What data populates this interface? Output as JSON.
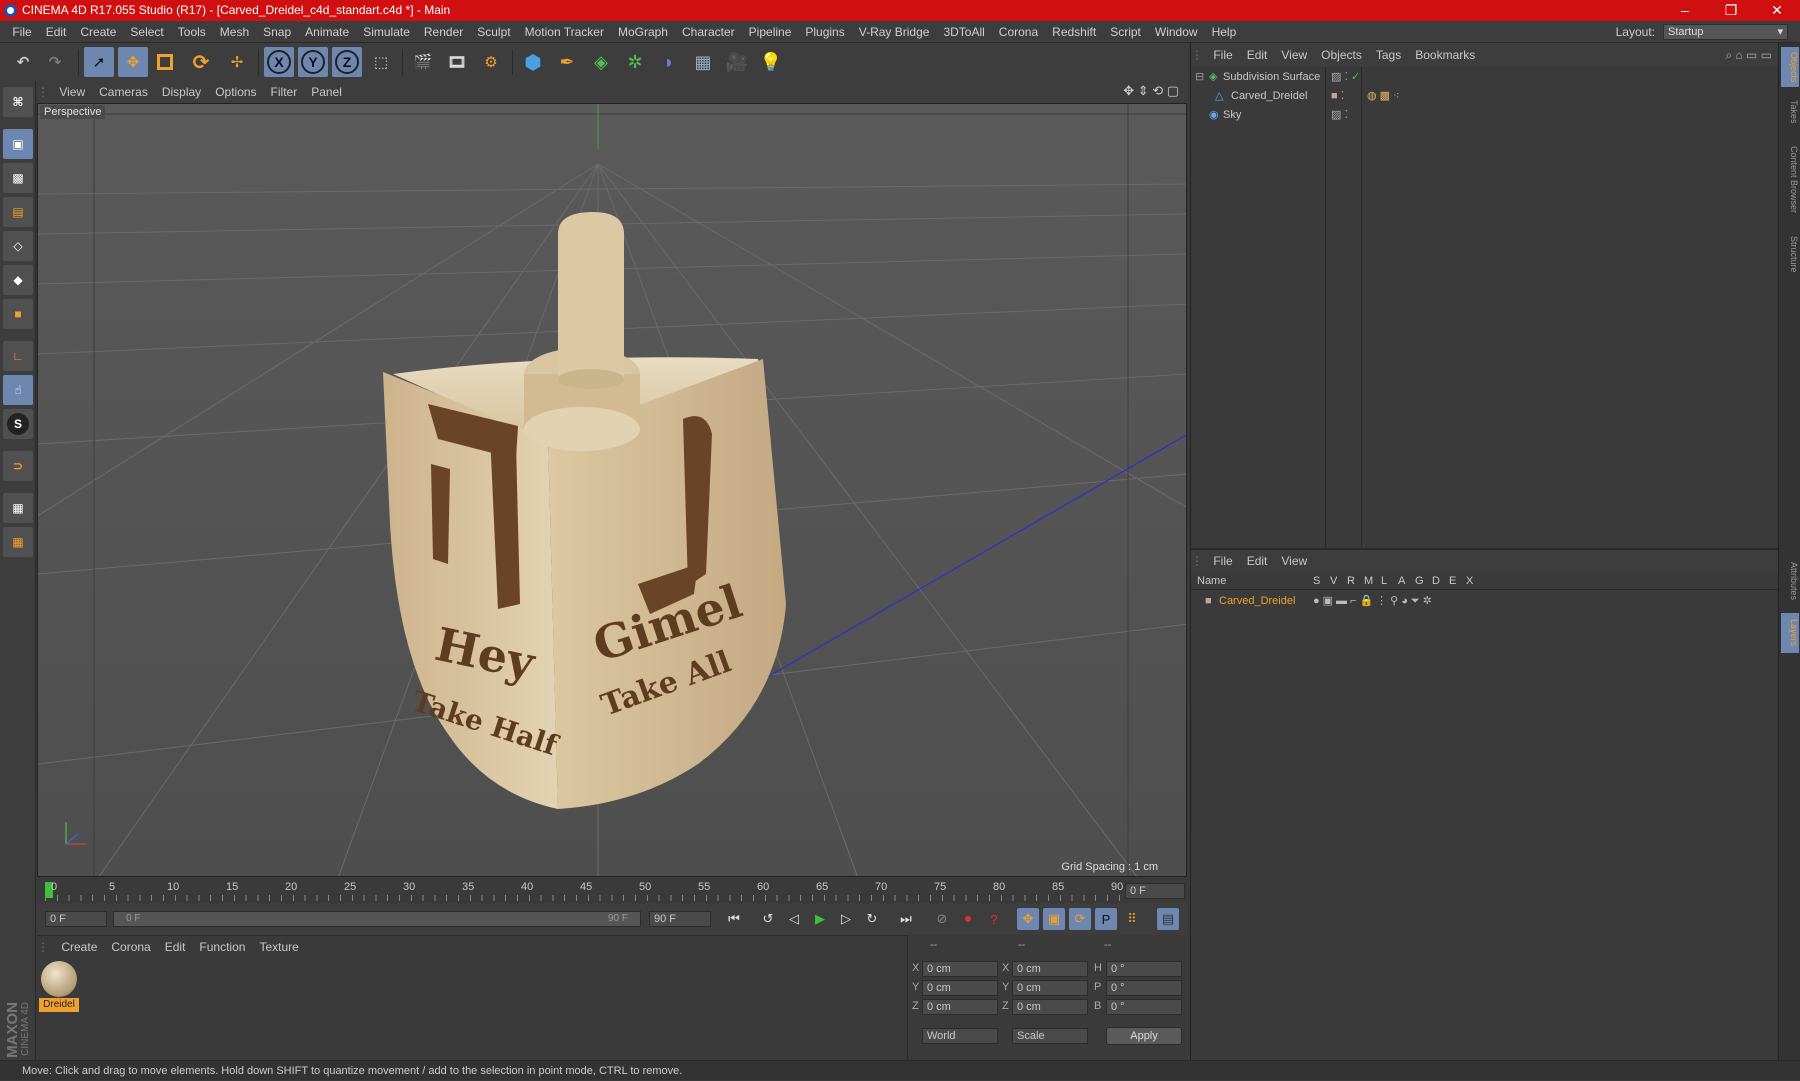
{
  "titlebar": {
    "title": "CINEMA 4D R17.055 Studio (R17) - [Carved_Dreidel_c4d_standart.c4d *] - Main",
    "minimize": "–",
    "maximize": "❐",
    "close": "✕"
  },
  "menubar": {
    "items": [
      "File",
      "Edit",
      "Create",
      "Select",
      "Tools",
      "Mesh",
      "Snap",
      "Animate",
      "Simulate",
      "Render",
      "Sculpt",
      "Motion Tracker",
      "MoGraph",
      "Character",
      "Pipeline",
      "Plugins",
      "V-Ray Bridge",
      "3DToAll",
      "Corona",
      "Redshift",
      "Script",
      "Window",
      "Help"
    ],
    "layout_label": "Layout:",
    "layout_value": "Startup"
  },
  "toolbar": {
    "x_label": "X",
    "y_label": "Y",
    "z_label": "Z"
  },
  "viewport": {
    "menu": [
      "View",
      "Cameras",
      "Display",
      "Options",
      "Filter",
      "Panel"
    ],
    "camera_label": "Perspective",
    "grid_spacing": "Grid Spacing : 1 cm",
    "carving": {
      "letter1_name": "Hey",
      "letter1_action": "Take Half",
      "letter2_name": "Gimel",
      "letter2_action": "Take All"
    }
  },
  "timeline": {
    "ticks": [
      "0",
      "5",
      "10",
      "15",
      "20",
      "25",
      "30",
      "35",
      "40",
      "45",
      "50",
      "55",
      "60",
      "65",
      "70",
      "75",
      "80",
      "85",
      "90"
    ],
    "current_frame": "0 F"
  },
  "transport": {
    "start_field": "0 F",
    "range_start": "0 F",
    "range_end": "90 F",
    "end_field": "90 F",
    "p_label": "P"
  },
  "material_manager": {
    "menu": [
      "Create",
      "Corona",
      "Edit",
      "Function",
      "Texture"
    ],
    "material_name": "Dreidel"
  },
  "coordinates": {
    "header": [
      "--",
      "--",
      "--"
    ],
    "rows": [
      {
        "a": "X",
        "v1": "0 cm",
        "b": "X",
        "v2": "0 cm",
        "c": "H",
        "v3": "0 °"
      },
      {
        "a": "Y",
        "v1": "0 cm",
        "b": "Y",
        "v2": "0 cm",
        "c": "P",
        "v3": "0 °"
      },
      {
        "a": "Z",
        "v1": "0 cm",
        "b": "Z",
        "v2": "0 cm",
        "c": "B",
        "v3": "0 °"
      }
    ],
    "world": "World",
    "scale": "Scale",
    "apply": "Apply"
  },
  "object_manager": {
    "menu": [
      "File",
      "Edit",
      "View",
      "Objects",
      "Tags",
      "Bookmarks"
    ],
    "objects": [
      "Subdivision Surface",
      "Carved_Dreidel",
      "Sky"
    ]
  },
  "layer_manager": {
    "menu": [
      "File",
      "Edit",
      "View"
    ],
    "columns": [
      "Name",
      "S",
      "V",
      "R",
      "M",
      "L",
      "A",
      "G",
      "D",
      "E",
      "X"
    ],
    "layer_name": "Carved_Dreidel"
  },
  "right_tabs": [
    "Objects",
    "Takes",
    "Content Browser",
    "Structure",
    "Attributes",
    "Layers"
  ],
  "brand": {
    "maxon": "MAXON",
    "cinema": "CINEMA 4D"
  },
  "statusbar": {
    "text": "Move: Click and drag to move elements. Hold down SHIFT to quantize movement / add to the selection in point mode, CTRL to remove."
  },
  "colors": {
    "title_red": "#d01010",
    "highlight_blue": "#6e87b0",
    "orange": "#f0a030",
    "selected_text": "#f0a030"
  }
}
